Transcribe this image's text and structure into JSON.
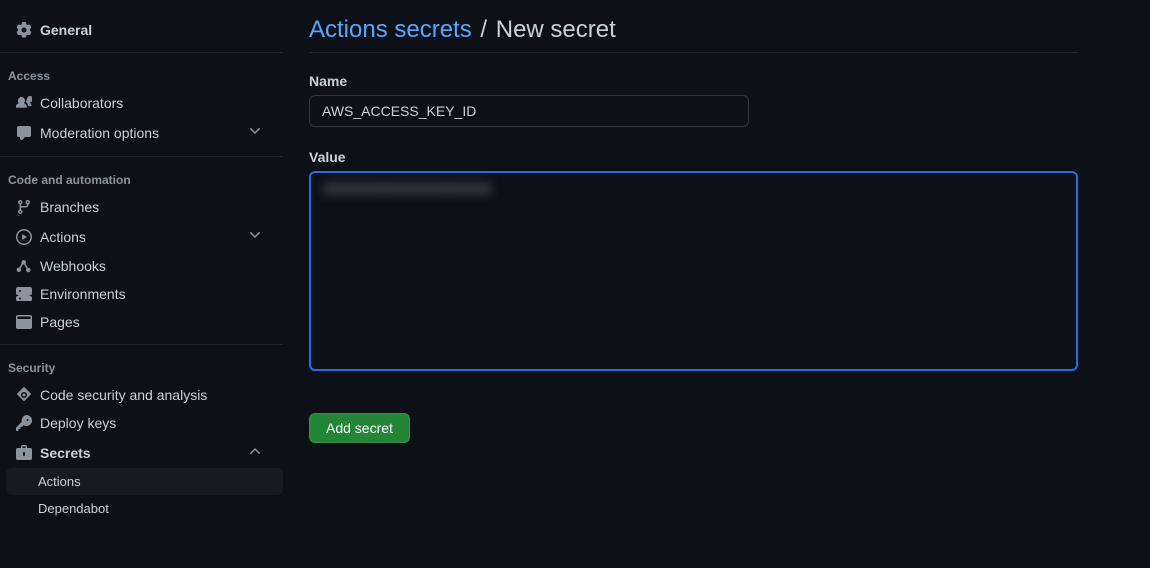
{
  "sidebar": {
    "general": "General",
    "sections": {
      "access": {
        "header": "Access",
        "collaborators": "Collaborators",
        "moderation": "Moderation options"
      },
      "code": {
        "header": "Code and automation",
        "branches": "Branches",
        "actions": "Actions",
        "webhooks": "Webhooks",
        "environments": "Environments",
        "pages": "Pages"
      },
      "security": {
        "header": "Security",
        "code_security": "Code security and analysis",
        "deploy_keys": "Deploy keys",
        "secrets": "Secrets",
        "secrets_sub": {
          "actions": "Actions",
          "dependabot": "Dependabot"
        }
      }
    }
  },
  "main": {
    "breadcrumb_link": "Actions secrets",
    "breadcrumb_sep": "/",
    "breadcrumb_current": "New secret",
    "name_label": "Name",
    "name_value": "AWS_ACCESS_KEY_ID",
    "value_label": "Value",
    "value_masked": "XXXXXXXXXXXXXXXXXXXX",
    "submit_label": "Add secret"
  }
}
